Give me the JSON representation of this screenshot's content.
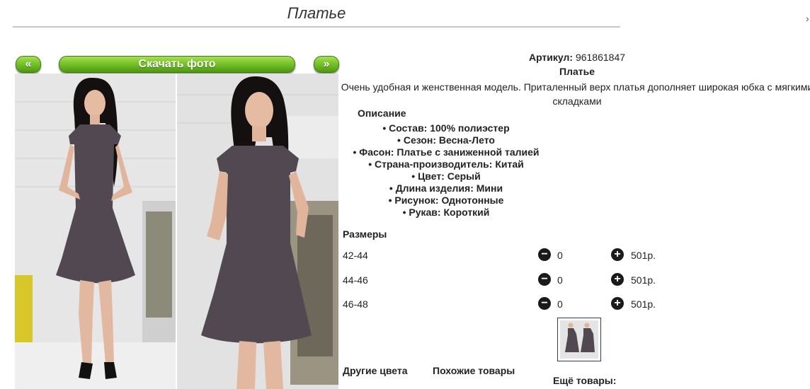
{
  "page": {
    "title": "Платье",
    "close_glyph": "›"
  },
  "gallery": {
    "prev": "«",
    "next": "»",
    "download": "Скачать фото"
  },
  "product": {
    "sku_label": "Артикул:",
    "sku_value": "961861847",
    "name": "Платье",
    "description": "Очень удобная и женственная модель. Приталенный верх платья дополняет широкая юбка с мягкими складками",
    "description_label": "Описание",
    "specs": [
      "Состав: 100% полиэстер",
      "Сезон: Весна-Лето",
      "Фасон: Платье с заниженной талией",
      "Страна-производитель: Китай",
      "Цвет: Серый",
      "Длина изделия: Мини",
      "Рисунок: Однотонные",
      "Рукав: Короткий"
    ]
  },
  "sizes": {
    "label": "Размеры",
    "rows": [
      {
        "size": "42-44",
        "qty": "0",
        "price": "501р."
      },
      {
        "size": "44-46",
        "qty": "0",
        "price": "501р."
      },
      {
        "size": "46-48",
        "qty": "0",
        "price": "501р."
      }
    ],
    "minus": "−",
    "plus": "+"
  },
  "footer": {
    "other_colors": "Другие цвета",
    "similar": "Похожие товары",
    "more": "Ещё товары:"
  },
  "colors": {
    "button_green": "#78c22c",
    "dress": "#524852"
  }
}
